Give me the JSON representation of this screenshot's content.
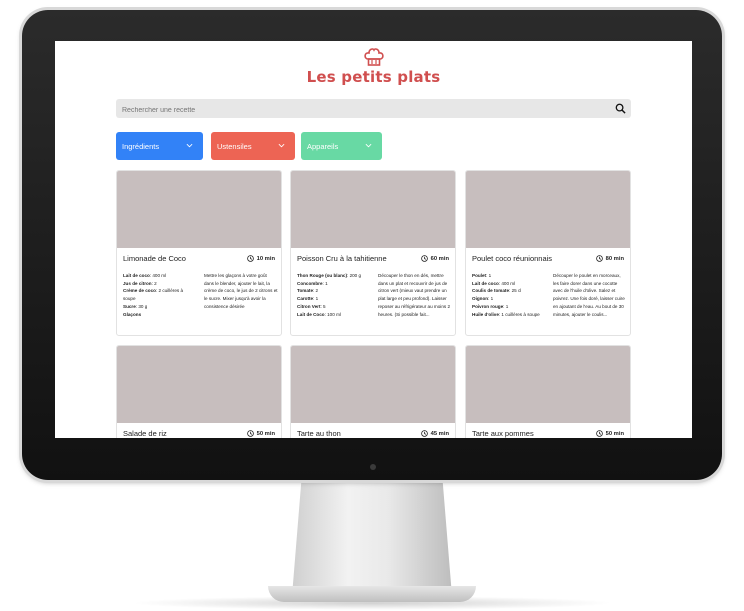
{
  "app": {
    "title": "Les petits plats"
  },
  "search": {
    "placeholder": "Rechercher une recette"
  },
  "filters": [
    {
      "label": "Ingrédients",
      "color": "#3282F7"
    },
    {
      "label": "Ustensiles",
      "color": "#ED6454"
    },
    {
      "label": "Appareils",
      "color": "#68D9A4"
    }
  ],
  "colors": {
    "brand": "#D04F4F",
    "image_placeholder": "#C7BEBE"
  },
  "recipes": [
    {
      "title": "Limonade de Coco",
      "time": "10 min",
      "ingredients": [
        {
          "name": "Lait de coco",
          "qty": ": 400 ml"
        },
        {
          "name": "Jus de citron",
          "qty": ": 2"
        },
        {
          "name": "Crème de coco",
          "qty": ": 2 cuillères à soupe"
        },
        {
          "name": "Sucre",
          "qty": ": 30 g"
        },
        {
          "name": "Glaçons",
          "qty": ""
        }
      ],
      "description": "Mettre les glaçons à votre goût dans le blender, ajouter le lait, la crème de coco, le jus de 2 citrons et le sucre. Mixer jusqu'à avoir la consistence désirée"
    },
    {
      "title": "Poisson Cru à la tahitienne",
      "time": "60 min",
      "ingredients": [
        {
          "name": "Thon Rouge (ou blanc)",
          "qty": ": 200 g"
        },
        {
          "name": "Concombre",
          "qty": ": 1"
        },
        {
          "name": "Tomate",
          "qty": ": 2"
        },
        {
          "name": "Carotte",
          "qty": ": 1"
        },
        {
          "name": "Citron Vert",
          "qty": ": 5"
        },
        {
          "name": "Lait de Coco",
          "qty": ": 100 ml"
        }
      ],
      "description": "Découper le thon en dés, mettre dans un plat et recouvrir de jus de citron vert (mieux vaut prendre un plat large et peu profond). Laisser reposer au réfrigérateur au moins 2 heures. (Si possible fait..."
    },
    {
      "title": "Poulet coco réunionnais",
      "time": "80 min",
      "ingredients": [
        {
          "name": "Poulet",
          "qty": ": 1"
        },
        {
          "name": "Lait de coco",
          "qty": ": 400 ml"
        },
        {
          "name": "Coulis de tomate",
          "qty": ": 25 cl"
        },
        {
          "name": "Oignon",
          "qty": ": 1"
        },
        {
          "name": "Poivron rouge",
          "qty": ": 1"
        },
        {
          "name": "Huile d'olive",
          "qty": ": 1 cuillères à soupe"
        }
      ],
      "description": "Découper le poulet en morceaux, les faire dorer dans une cocotte avec de l'huile d'olive. Salez et poivrez. Une fois doré, laisser cuire en ajoutant de l'eau. Au bout de 30 minutes, ajouter le coulis..."
    },
    {
      "title": "Salade de riz",
      "time": "50 min",
      "ingredients": [],
      "description": ""
    },
    {
      "title": "Tarte au thon",
      "time": "45 min",
      "ingredients": [],
      "description": ""
    },
    {
      "title": "Tarte aux pommes",
      "time": "50 min",
      "ingredients": [],
      "description": ""
    }
  ]
}
